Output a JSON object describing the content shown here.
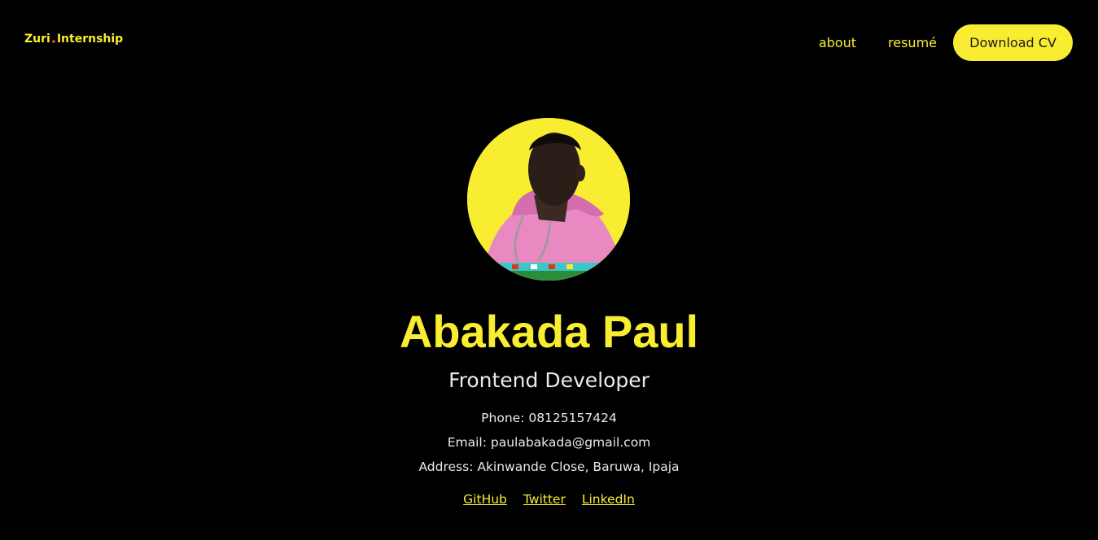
{
  "header": {
    "logo": {
      "part1": "Zuri",
      "part2": "Internship"
    },
    "nav": {
      "about_label": "about",
      "resume_label": "resumé",
      "download_label": "Download CV"
    }
  },
  "profile": {
    "avatar_alt": "profile photo",
    "name": "Abakada Paul",
    "role": "Frontend Developer",
    "phone_line": "Phone: 08125157424",
    "email_line": "Email: paulabakada@gmail.com",
    "address_line": "Address: Akinwande Close, Baruwa, Ipaja"
  },
  "socials": {
    "github": "GitHub",
    "twitter": "Twitter",
    "linkedin": "LinkedIn"
  },
  "colors": {
    "accent": "#F9ED32",
    "background": "#000000",
    "text": "#ECE9E6",
    "logo_dot": "#E8331C"
  }
}
